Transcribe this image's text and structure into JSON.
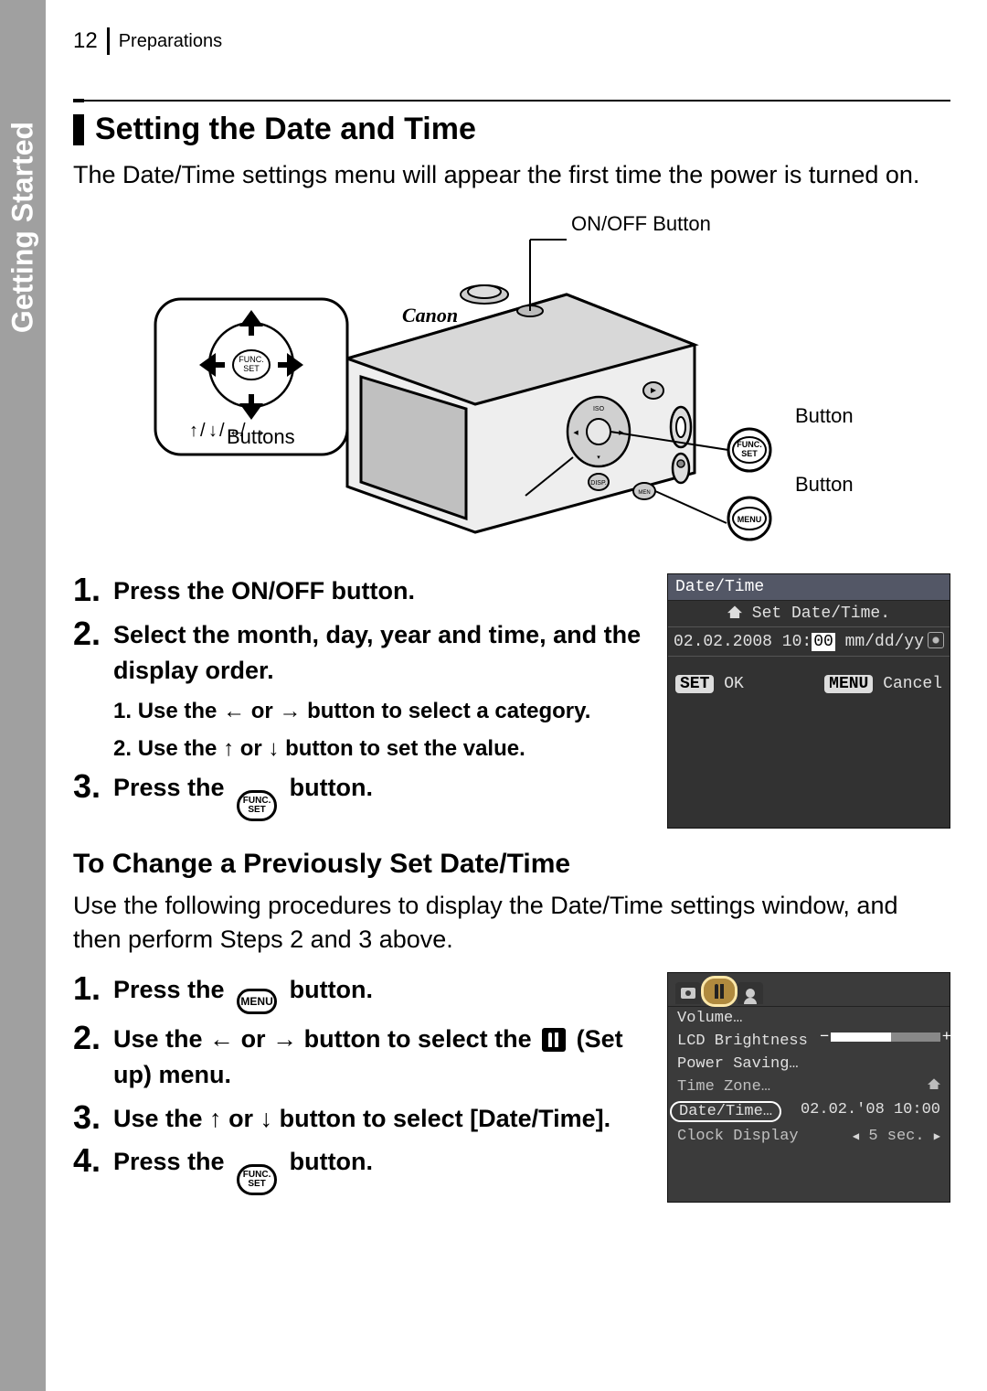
{
  "side_tab": "Getting Started",
  "page_number": "12",
  "breadcrumb": "Preparations",
  "heading": "Setting the Date and Time",
  "intro": "The Date/Time settings menu will appear the first time the power is turned on.",
  "diagram": {
    "onoff_label": "ON/OFF Button",
    "func_label": "Button",
    "func_badge_top": "FUNC.",
    "func_badge_bottom": "SET",
    "menu_label": "Button",
    "menu_badge": "MENU",
    "dpad_label": "Buttons",
    "brand": "Canon"
  },
  "steps_a": {
    "s1": "Press the ON/OFF button.",
    "s2": "Select the month, day, year and time, and the display order.",
    "s2_sub1_pre": "Use the ",
    "s2_sub1_post": " button to select a category.",
    "s2_sub2_pre": "Use the ",
    "s2_sub2_post": " button to set the value.",
    "s3_pre": "Press the ",
    "s3_post": " button."
  },
  "change_heading": "To Change a Previously Set Date/Time",
  "change_intro": "Use the following procedures to display the Date/Time settings window, and then perform Steps 2 and 3 above.",
  "steps_b": {
    "s1_pre": "Press the ",
    "s1_post": " button.",
    "s2_pre": "Use the ",
    "s2_mid1": " button to select the ",
    "s2_post": " (Set up) menu.",
    "s3_pre": "Use the ",
    "s3_post": " button to select [Date/Time].",
    "s4_pre": "Press the ",
    "s4_post": " button."
  },
  "lcd1": {
    "title": "Date/Time",
    "sub": "Set Date/Time.",
    "date": "02.02.2008 10:",
    "date_hl": "00",
    "fmt": " mm/dd/yy",
    "set_label": "SET",
    "ok": "OK",
    "menu_label": "MENU",
    "cancel": "Cancel"
  },
  "lcd2": {
    "rows": [
      {
        "label": "Volume…",
        "value": ""
      },
      {
        "label": "LCD Brightness",
        "value": ""
      },
      {
        "label": "Power Saving…",
        "value": ""
      },
      {
        "label": "Time Zone…",
        "value": ""
      },
      {
        "label": "Date/Time…",
        "value": "02.02.'08 10:00"
      },
      {
        "label": "Clock Display",
        "value": "5 sec."
      }
    ]
  }
}
